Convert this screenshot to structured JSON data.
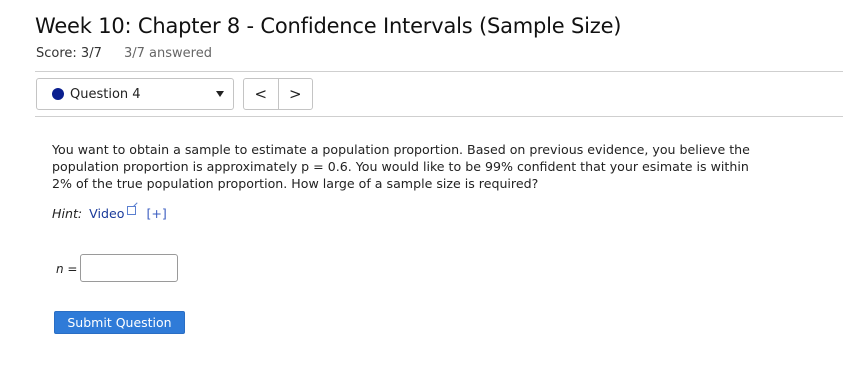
{
  "header": {
    "title": "Week 10: Chapter 8 - Confidence Intervals (Sample Size)",
    "score": "Score: 3/7",
    "answered": "3/7 answered"
  },
  "question_nav": {
    "selected": "Question 4",
    "prev_glyph": "<",
    "next_glyph": ">",
    "status_color": "#0a1f8f"
  },
  "question": {
    "text": "You want to obtain a sample to estimate a population proportion. Based on previous evidence, you believe the population proportion is approximately p = 0.6. You would like to be 99% confident that your esimate is within 2% of the true population proportion. How large of a sample size is required?"
  },
  "hint": {
    "label": "Hint:",
    "video_label": "Video",
    "expand_label": "[+]"
  },
  "answer": {
    "label": "n =",
    "value": "",
    "placeholder": ""
  },
  "submit": {
    "label": "Submit Question"
  },
  "colors": {
    "submit_bg": "#2f7bd8",
    "link": "#1a3a9a"
  }
}
